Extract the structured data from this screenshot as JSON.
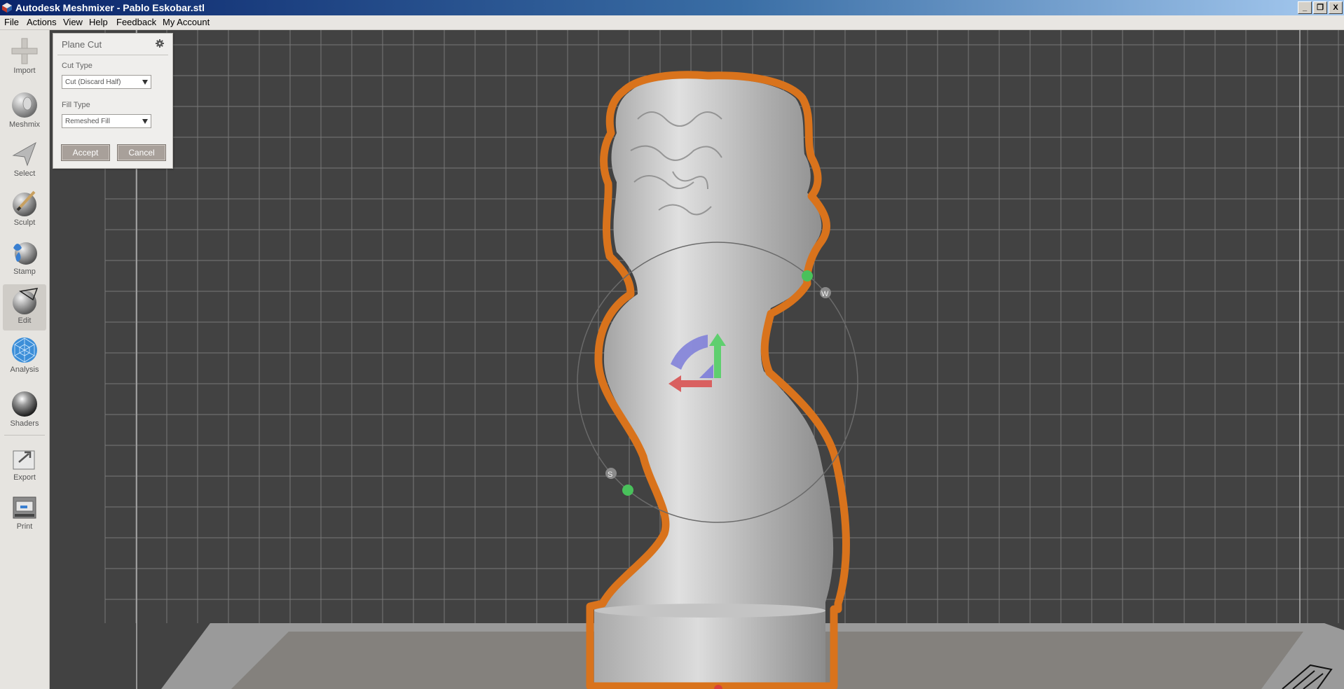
{
  "window": {
    "title": "Autodesk Meshmixer - Pablo Eskobar.stl",
    "controls": {
      "minimize": "_",
      "restore": "❐",
      "close": "X"
    }
  },
  "menubar": {
    "items": [
      "File",
      "Actions",
      "View",
      "Help",
      "Feedback",
      "My Account"
    ]
  },
  "toolbar": {
    "items": [
      {
        "label": "Import",
        "icon": "plus-icon"
      },
      {
        "label": "Meshmix",
        "icon": "meshmix-head-icon"
      },
      {
        "label": "Select",
        "icon": "select-arrow-icon"
      },
      {
        "label": "Sculpt",
        "icon": "sculpt-brush-icon"
      },
      {
        "label": "Stamp",
        "icon": "stamp-icon"
      },
      {
        "label": "Edit",
        "icon": "edit-sphere-icon",
        "active": true
      },
      {
        "label": "Analysis",
        "icon": "analysis-mesh-icon"
      },
      {
        "label": "Shaders",
        "icon": "shaders-sphere-icon"
      },
      {
        "label": "Export",
        "icon": "export-icon"
      },
      {
        "label": "Print",
        "icon": "printer-icon"
      }
    ]
  },
  "panel": {
    "title": "Plane Cut",
    "cut_type_label": "Cut Type",
    "cut_type_value": "Cut (Discard Half)",
    "fill_type_label": "Fill Type",
    "fill_type_value": "Remeshed Fill",
    "accept_label": "Accept",
    "cancel_label": "Cancel"
  },
  "viewport": {
    "gizmo_labels": [
      "W",
      "S"
    ],
    "colors": {
      "background": "#424242",
      "grid": "#8c8c8c",
      "outline": "#d9731c",
      "model": "#b8b8b8",
      "gizmo_up": "#5fcf6f",
      "gizmo_left": "#d96060",
      "gizmo_rotate": "#7c7cd9"
    }
  }
}
